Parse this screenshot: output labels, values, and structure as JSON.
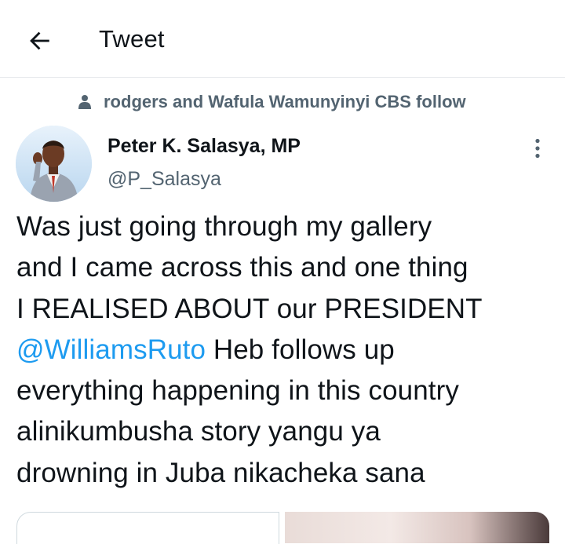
{
  "header": {
    "back_icon": "arrow-left-icon",
    "title": "Tweet"
  },
  "social_context": {
    "icon": "person-icon",
    "text": "rodgers and Wafula Wamunyinyi CBS follow"
  },
  "tweet": {
    "author": {
      "name": "Peter K. Salasya, MP",
      "handle": "@P_Salasya"
    },
    "more_icon": "more-vertical-icon",
    "text_before": "Was just going through my gallery\nand I came across this and one thing\nI REALISED ABOUT our  PRESIDENT\n",
    "mention": "@WilliamsRuto",
    "text_after": " Heb follows up\neverything happening in this country\nalinikumbusha story yangu ya\ndrowning in Juba nikacheka sana"
  },
  "colors": {
    "text_primary": "#0f1419",
    "text_secondary": "#536471",
    "link": "#1d9bf0",
    "divider": "#e6e9ec"
  }
}
